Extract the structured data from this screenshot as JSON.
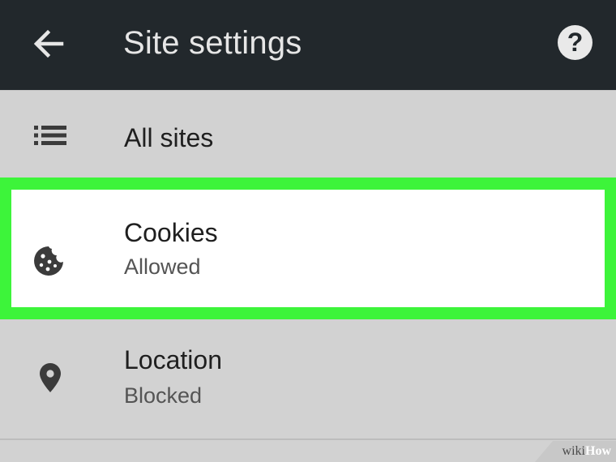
{
  "app_bar": {
    "title": "Site settings",
    "back_icon": "arrow-left-icon",
    "help_label": "?",
    "help_icon": "help-circle-icon",
    "background": "#22282c"
  },
  "rows": [
    {
      "label": "All sites",
      "icon": "list-icon"
    },
    {
      "label": "Cookies",
      "sublabel": "Allowed",
      "icon": "cookie-icon",
      "highlighted": true,
      "highlight_color": "#3df43a"
    },
    {
      "label": "Location",
      "sublabel": "Blocked",
      "icon": "location-pin-icon"
    }
  ],
  "watermark": {
    "part1": "wiki",
    "part2": "How"
  }
}
